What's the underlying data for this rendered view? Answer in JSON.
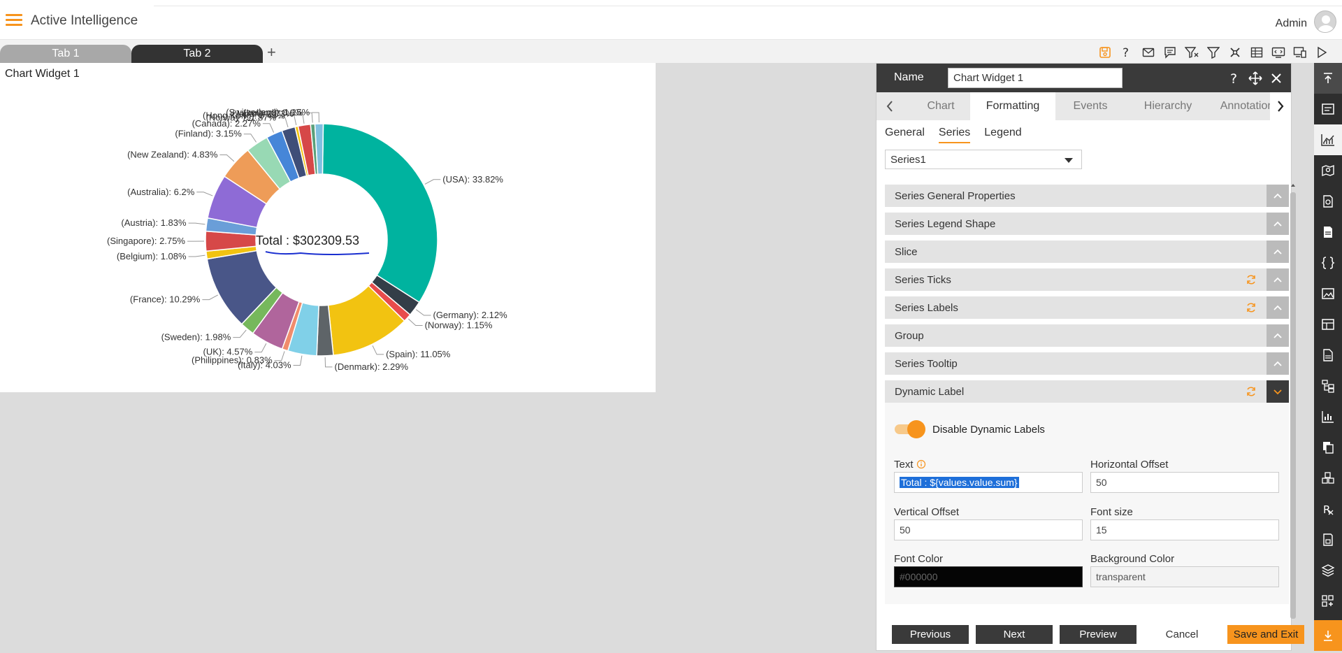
{
  "app": {
    "title": "Active Intelligence",
    "user": "Admin"
  },
  "tabs": [
    {
      "label": "Tab 1"
    },
    {
      "label": "Tab 2"
    }
  ],
  "tab_add": "+",
  "toolbar_icons": [
    "save-icon",
    "help-icon",
    "mail-icon",
    "comment-icon",
    "clear-filter-icon",
    "filter-icon",
    "settings-icon",
    "table-icon",
    "embed-icon",
    "devices-icon",
    "play-icon"
  ],
  "widget": {
    "title": "Chart Widget 1"
  },
  "chart_data": {
    "type": "pie",
    "donut": true,
    "center_label": "Total : $302309.53",
    "slices": [
      {
        "label": "(USA): 33.82%",
        "value": 33.82,
        "color": "#00b39f"
      },
      {
        "label": "(Germany): 2.12%",
        "value": 2.12,
        "color": "#333e48"
      },
      {
        "label": "(Norway): 1.15%",
        "value": 1.15,
        "color": "#e84c4c"
      },
      {
        "label": "(Spain): 11.05%",
        "value": 11.05,
        "color": "#f2c311"
      },
      {
        "label": "(Denmark): 2.29%",
        "value": 2.29,
        "color": "#5e6468"
      },
      {
        "label": "(Italy): 4.03%",
        "value": 4.03,
        "color": "#80d0e8"
      },
      {
        "label": "(Philippines): 0.83%",
        "value": 0.83,
        "color": "#f08c6c"
      },
      {
        "label": "(UK): 4.57%",
        "value": 4.57,
        "color": "#b0659c"
      },
      {
        "label": "(Sweden): 1.98%",
        "value": 1.98,
        "color": "#76b85c"
      },
      {
        "label": "(France): 10.29%",
        "value": 10.29,
        "color": "#495688"
      },
      {
        "label": "(Belgium): 1.08%",
        "value": 1.08,
        "color": "#f2c311"
      },
      {
        "label": "(Singapore): 2.75%",
        "value": 2.75,
        "color": "#d64848"
      },
      {
        "label": "(Austria): 1.83%",
        "value": 1.83,
        "color": "#6a9ed8"
      },
      {
        "label": "(Australia): 6.2%",
        "value": 6.2,
        "color": "#8e6bd6"
      },
      {
        "label": "(New Zealand): 4.83%",
        "value": 4.83,
        "color": "#ee9c58"
      },
      {
        "label": "(Finland): 3.15%",
        "value": 3.15,
        "color": "#98d9b4"
      },
      {
        "label": "(Canada): 2.27%",
        "value": 2.27,
        "color": "#4686d8"
      },
      {
        "label": "(Norway ): 1.87%",
        "value": 1.87,
        "color": "#3f4e78"
      },
      {
        "label": "(Hong Kong): 0.43%",
        "value": 0.43,
        "color": "#f2c311"
      },
      {
        "label": "(Japan): 1.73%",
        "value": 1.73,
        "color": "#d64848"
      },
      {
        "label": "(Ireland): 0.6%",
        "value": 0.6,
        "color": "#5aa07a"
      },
      {
        "label": "(Switzerland): 1.15%",
        "value": 1.15,
        "color": "#80c0e0"
      }
    ]
  },
  "panel": {
    "name_label": "Name",
    "name_value": "Chart Widget 1",
    "tabs": [
      "Chart",
      "Formatting",
      "Events",
      "Hierarchy",
      "Annotation"
    ],
    "active_tab": "Formatting",
    "subtabs": [
      "General",
      "Series",
      "Legend"
    ],
    "active_subtab": "Series",
    "series_select": "Series1",
    "sections": [
      {
        "label": "Series General Properties",
        "refresh": false
      },
      {
        "label": "Series Legend Shape",
        "refresh": false
      },
      {
        "label": "Slice",
        "refresh": false
      },
      {
        "label": "Series Ticks",
        "refresh": true
      },
      {
        "label": "Series Labels",
        "refresh": true
      },
      {
        "label": "Group",
        "refresh": false
      },
      {
        "label": "Series Tooltip",
        "refresh": false
      },
      {
        "label": "Dynamic Label",
        "refresh": true
      }
    ],
    "dynamic": {
      "toggle_label": "Disable Dynamic Labels",
      "text_label": "Text",
      "text_value": "Total : ${values.value.sum}",
      "hoffset_label": "Horizontal Offset",
      "hoffset_value": "50",
      "voffset_label": "Vertical Offset",
      "voffset_value": "50",
      "fontsize_label": "Font size",
      "fontsize_value": "15",
      "fontcolor_label": "Font Color",
      "fontcolor_value": "#000000",
      "bgcolor_label": "Background Color",
      "bgcolor_value": "transparent"
    },
    "buttons": {
      "previous": "Previous",
      "next": "Next",
      "preview": "Preview",
      "cancel": "Cancel",
      "save": "Save and Exit"
    }
  },
  "colors": {
    "accent": "#f7941d",
    "dark": "#3a3a3a"
  }
}
